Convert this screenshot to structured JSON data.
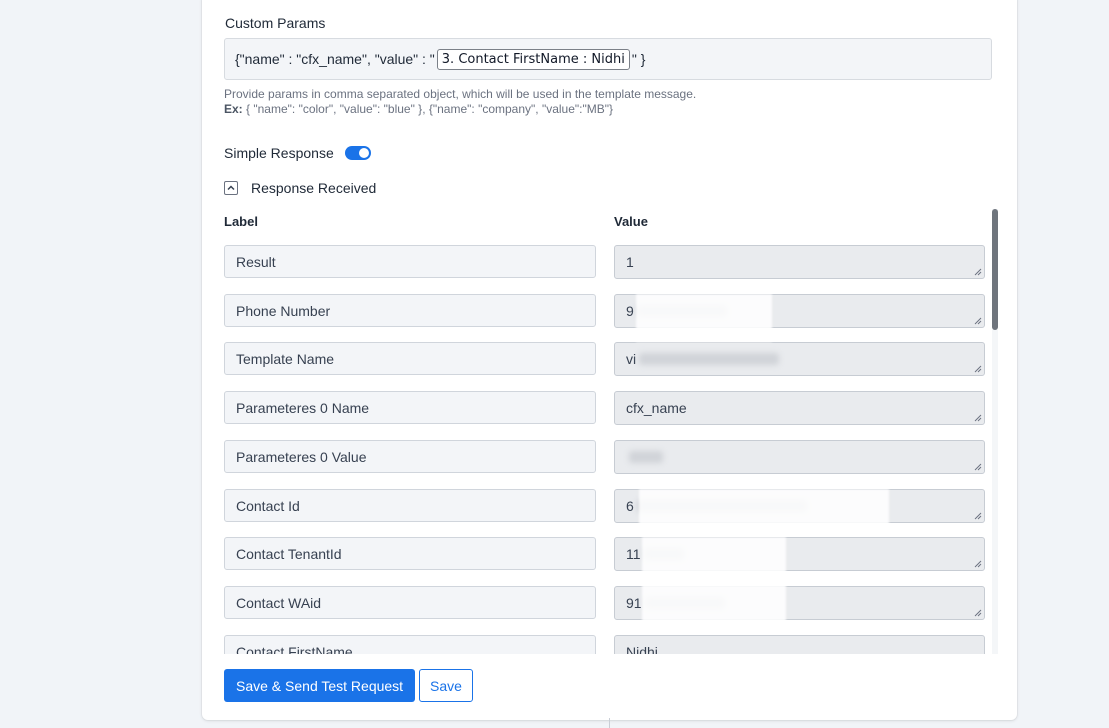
{
  "custom_params": {
    "title": "Custom Params",
    "prefix": "{\"name\" : \"cfx_name\", \"value\" : \"",
    "chip": "3. Contact FirstName : Nidhi",
    "suffix": "\" }",
    "help_line1": "Provide params in comma separated object, which will be used in the template message.",
    "help_ex_label": "Ex:",
    "help_ex_text": " { \"name\": \"color\", \"value\": \"blue\" }, {\"name\": \"company\", \"value\":\"MB\"}"
  },
  "simple_response": {
    "label": "Simple Response",
    "enabled": true,
    "toggle_color": "#1a73e8"
  },
  "response_received": {
    "label": "Response Received",
    "expanded": true,
    "icon": "chevron-up-icon"
  },
  "table": {
    "label_header": "Label",
    "value_header": "Value",
    "rows": [
      {
        "label": "Result",
        "value": "1"
      },
      {
        "label": "Phone Number",
        "value": "9"
      },
      {
        "label": "Template Name",
        "value": "vi"
      },
      {
        "label": "Parameteres 0 Name",
        "value": "cfx_name"
      },
      {
        "label": "Parameteres 0 Value",
        "value": ""
      },
      {
        "label": "Contact Id",
        "value": "6"
      },
      {
        "label": "Contact TenantId",
        "value": "11"
      },
      {
        "label": "Contact WAid",
        "value": "91"
      },
      {
        "label": "Contact FirstName",
        "value": "Nidhi"
      }
    ]
  },
  "actions": {
    "primary_label": "Save & Send Test Request",
    "secondary_label": "Save",
    "accent_color": "#1a73e8"
  }
}
